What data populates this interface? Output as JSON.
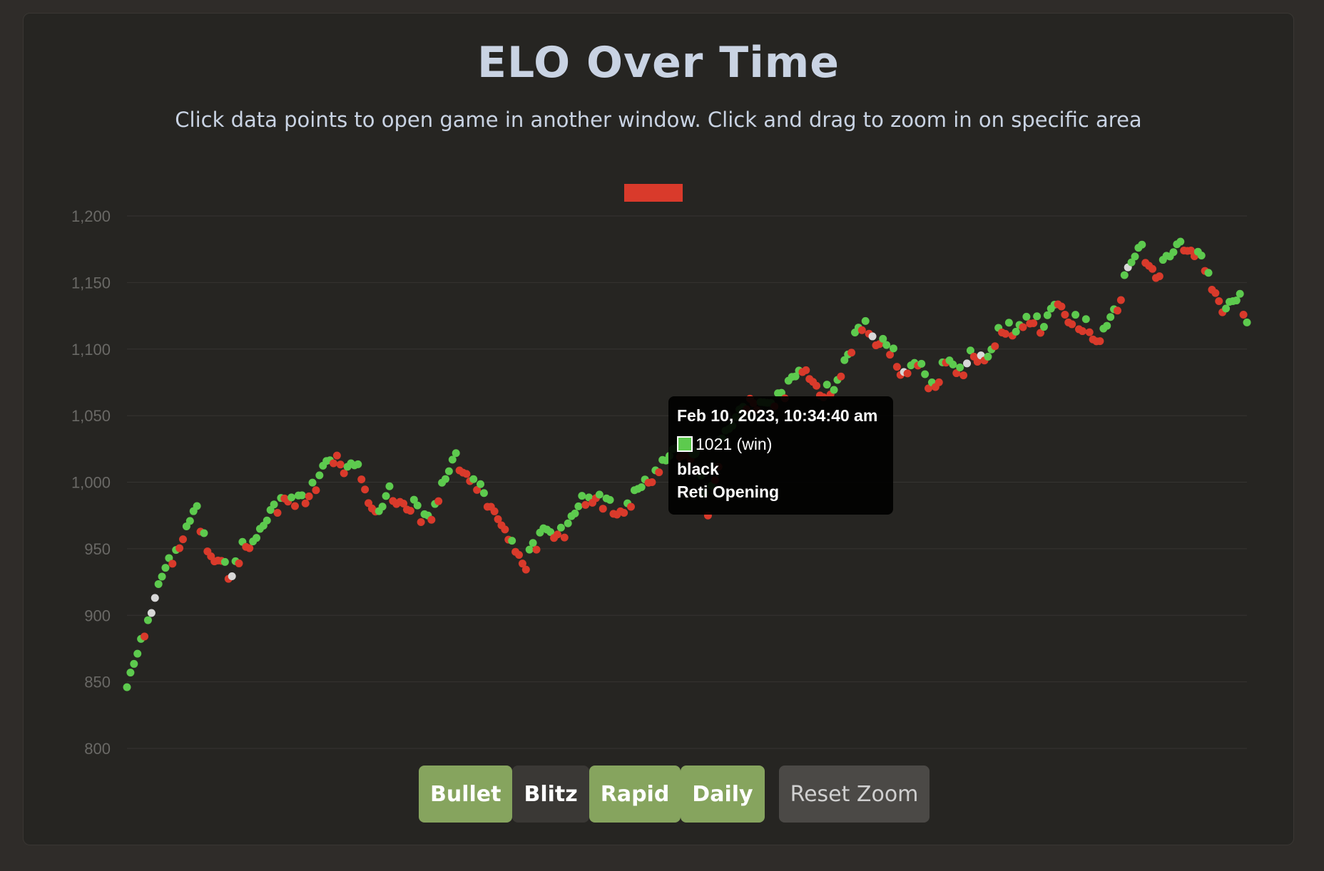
{
  "header": {
    "title": "ELO Over Time",
    "subtitle": "Click data points to open game in another window. Click and drag to zoom in on specific area"
  },
  "colors": {
    "win": "#5dca4e",
    "loss": "#d93a2b",
    "draw": "#d8d8d8",
    "legend_swatch": "#d93a2b",
    "grid": "#363431",
    "tick": "#6a6966"
  },
  "tooltip": {
    "date": "Feb 10, 2023, 10:34:40 am",
    "rating_result": "1021 (win)",
    "color": "black",
    "opening": "Reti Opening"
  },
  "buttons": {
    "bullet": "Bullet",
    "blitz": "Blitz",
    "rapid": "Rapid",
    "daily": "Daily",
    "reset_zoom": "Reset Zoom"
  },
  "chart_data": {
    "type": "scatter",
    "title": "ELO Over Time",
    "ylim": [
      800,
      1200
    ],
    "yticks": [
      800,
      850,
      900,
      950,
      1000,
      1050,
      1100,
      1150,
      1200
    ],
    "ytick_labels": [
      "800",
      "850",
      "900",
      "950",
      "1,000",
      "1,050",
      "1,100",
      "1,150",
      "1,200"
    ],
    "grid": true,
    "legend": "top-center",
    "x": "game index (chronological, no x tick labels shown)",
    "anchors": [
      [
        0,
        843
      ],
      [
        3,
        870
      ],
      [
        7,
        903
      ],
      [
        10,
        928
      ],
      [
        14,
        948
      ],
      [
        17,
        965
      ],
      [
        20,
        978
      ],
      [
        23,
        950
      ],
      [
        27,
        943
      ],
      [
        30,
        928
      ],
      [
        33,
        953
      ],
      [
        37,
        955
      ],
      [
        41,
        975
      ],
      [
        45,
        990
      ],
      [
        49,
        985
      ],
      [
        53,
        995
      ],
      [
        57,
        1012
      ],
      [
        60,
        1022
      ],
      [
        63,
        1008
      ],
      [
        66,
        1012
      ],
      [
        69,
        990
      ],
      [
        72,
        975
      ],
      [
        75,
        992
      ],
      [
        78,
        988
      ],
      [
        82,
        982
      ],
      [
        86,
        970
      ],
      [
        90,
        995
      ],
      [
        94,
        1018
      ],
      [
        98,
        1005
      ],
      [
        102,
        990
      ],
      [
        106,
        978
      ],
      [
        110,
        955
      ],
      [
        114,
        940
      ],
      [
        118,
        960
      ],
      [
        122,
        962
      ],
      [
        126,
        965
      ],
      [
        130,
        985
      ],
      [
        134,
        990
      ],
      [
        138,
        982
      ],
      [
        142,
        980
      ],
      [
        146,
        992
      ],
      [
        150,
        1005
      ],
      [
        154,
        1015
      ],
      [
        158,
        1025
      ],
      [
        162,
        1021
      ],
      [
        166,
        980
      ],
      [
        170,
        1030
      ],
      [
        174,
        1045
      ],
      [
        178,
        1065
      ],
      [
        182,
        1055
      ],
      [
        186,
        1062
      ],
      [
        190,
        1075
      ],
      [
        194,
        1088
      ],
      [
        198,
        1070
      ],
      [
        202,
        1068
      ],
      [
        206,
        1095
      ],
      [
        210,
        1120
      ],
      [
        214,
        1108
      ],
      [
        218,
        1100
      ],
      [
        222,
        1082
      ],
      [
        226,
        1090
      ],
      [
        230,
        1070
      ],
      [
        234,
        1092
      ],
      [
        238,
        1082
      ],
      [
        242,
        1098
      ],
      [
        246,
        1092
      ],
      [
        250,
        1118
      ],
      [
        254,
        1112
      ],
      [
        258,
        1125
      ],
      [
        262,
        1115
      ],
      [
        266,
        1138
      ],
      [
        270,
        1122
      ],
      [
        274,
        1118
      ],
      [
        278,
        1108
      ],
      [
        282,
        1125
      ],
      [
        286,
        1160
      ],
      [
        290,
        1175
      ],
      [
        294,
        1158
      ],
      [
        298,
        1168
      ],
      [
        302,
        1180
      ],
      [
        306,
        1172
      ],
      [
        310,
        1150
      ],
      [
        314,
        1128
      ],
      [
        318,
        1138
      ],
      [
        320,
        1118
      ]
    ],
    "n_points": 321,
    "result_counts_approx": {
      "win": 170,
      "loss": 140,
      "draw": 11
    },
    "highlight": {
      "index": 162,
      "elo": 1021,
      "result": "win"
    },
    "series": [
      {
        "name": "",
        "color": "#d93a2b"
      }
    ]
  }
}
